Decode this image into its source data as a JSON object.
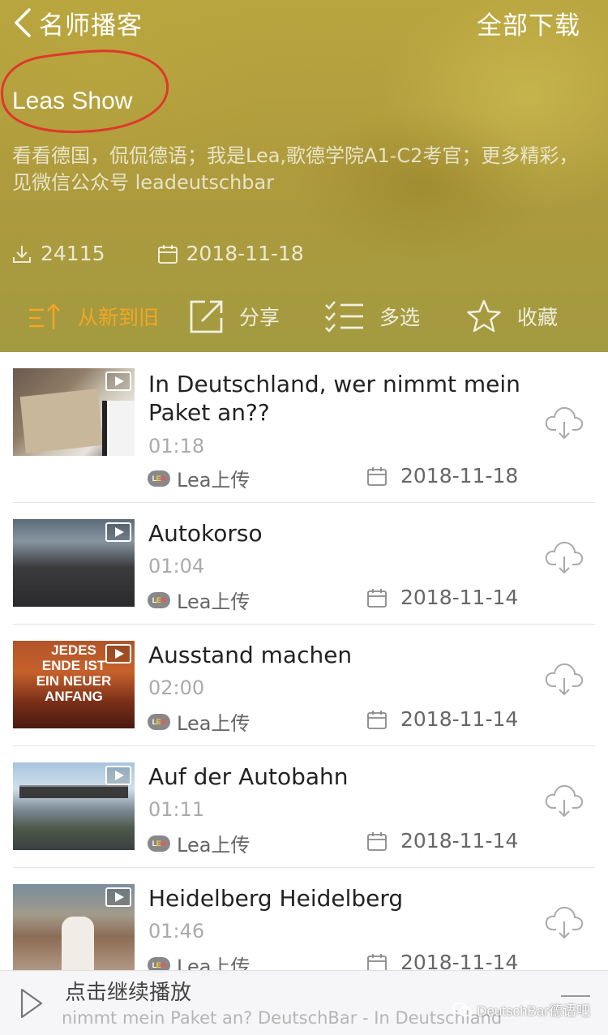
{
  "nav": {
    "back_title": "名师播客",
    "download_all": "全部下载"
  },
  "show": {
    "title": "Leas Show",
    "description": "看看德国，侃侃德语；我是Lea,歌德学院A1-C2考官；更多精彩，见微信公众号 leadeutschbar",
    "downloads": "24115",
    "date": "2018-11-18"
  },
  "actions": {
    "sort": "从新到旧",
    "share": "分享",
    "multi_select": "多选",
    "favorite": "收藏"
  },
  "colors": {
    "header_accent": "#b3a140",
    "sort_active": "#f5a623"
  },
  "episodes": [
    {
      "title": "In Deutschland, wer nimmt mein Paket an??",
      "duration": "01:18",
      "uploader": "Lea上传",
      "date": "2018-11-18",
      "logo": "LEA"
    },
    {
      "title": "Autokorso",
      "duration": "01:04",
      "uploader": "Lea上传",
      "date": "2018-11-14",
      "logo": "LEA"
    },
    {
      "title": "Ausstand machen",
      "duration": "02:00",
      "uploader": "Lea上传",
      "date": "2018-11-14",
      "logo": "LEA",
      "thumb_text": "JEDES\nENDE IST\nEIN NEUER\nANFANG"
    },
    {
      "title": "Auf der Autobahn",
      "duration": "01:11",
      "uploader": "Lea上传",
      "date": "2018-11-14",
      "logo": "LEA"
    },
    {
      "title": "Heidelberg Heidelberg",
      "duration": "01:46",
      "uploader": "Lea上传",
      "date": "2018-11-14",
      "logo": "LEA"
    }
  ],
  "player": {
    "main": "点击继续播放",
    "now_playing": "nimmt mein Paket an?   DeutschBar - In Deutschland"
  },
  "watermark": "DeutschBar德语吧"
}
